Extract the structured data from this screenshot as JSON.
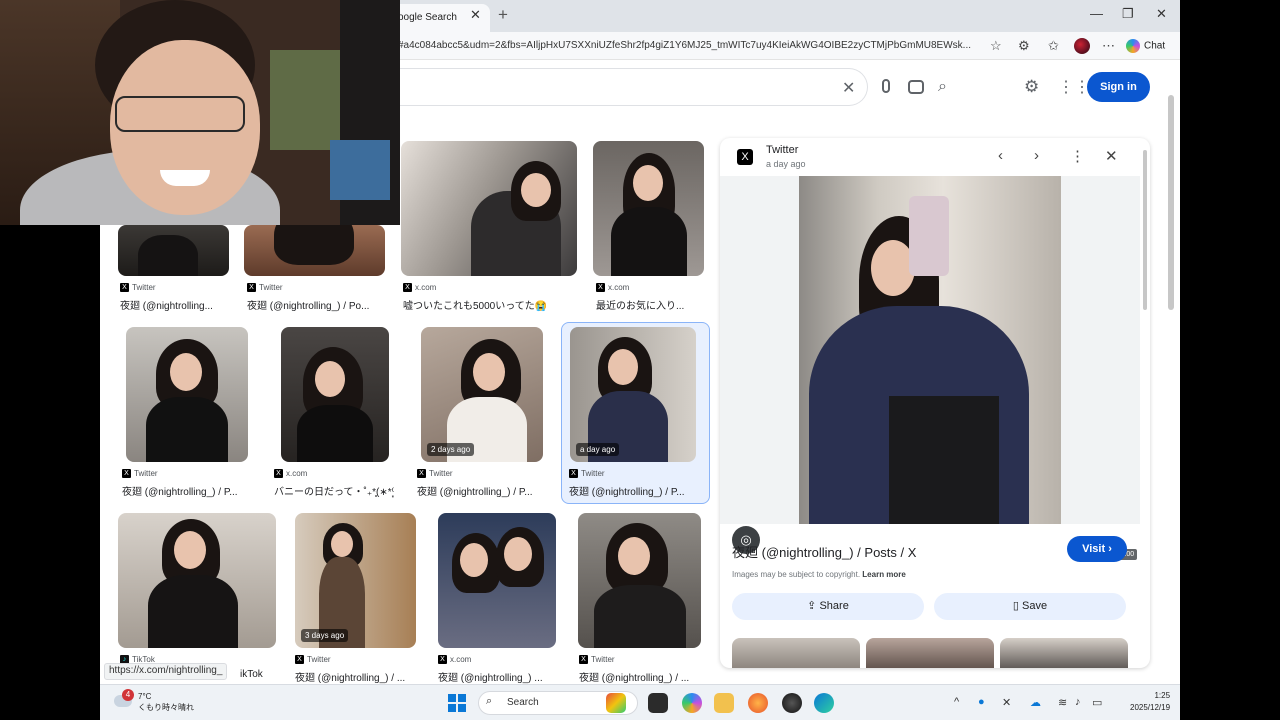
{
  "browser": {
    "tab_title": "oogle Search",
    "tab_close": "✕",
    "new_tab": "+",
    "url": "#a4c084abcc5&udm=2&fbs=AIljpHxU7SXXniUZfeShr2fp4giZ1Y6MJ25_tmWITc7uy4KIeiAkWG4OIBE2zyCTMjPbGmMU8EWsk...",
    "chat_label": "Chat",
    "window_buttons": [
      "—",
      "❐",
      "✕"
    ]
  },
  "google": {
    "signin_label": "Sign in"
  },
  "results": [
    {
      "source": "Twitter",
      "source_icon": "x",
      "caption": "夜廻 (@nightrolling..."
    },
    {
      "source": "Twitter",
      "source_icon": "x",
      "caption": "夜廻 (@nightrolling_) / Po..."
    },
    {
      "source": "x.com",
      "source_icon": "x",
      "caption": "嘘ついたこれも5000いってた😭"
    },
    {
      "source": "x.com",
      "source_icon": "x",
      "caption": "最近のお気に入り..."
    },
    {
      "source": "Twitter",
      "source_icon": "x",
      "caption": "夜廻 (@nightrolling_) / P..."
    },
    {
      "source": "x.com",
      "source_icon": "x",
      "caption": "バニーの日だって‧˚₊*̥(∗︎*⁰͈꒨⁰͈)‧˚₊*̥"
    },
    {
      "source": "Twitter",
      "source_icon": "x",
      "caption": "夜廻 (@nightrolling_) / P...",
      "ago": "2 days ago"
    },
    {
      "source": "Twitter",
      "source_icon": "x",
      "caption": "夜廻 (@nightrolling_) / P...",
      "ago": "a day ago"
    },
    {
      "source": "TikTok",
      "source_icon": "tiktok",
      "caption": "ikTok"
    },
    {
      "source": "Twitter",
      "source_icon": "x",
      "caption": "夜廻 (@nightrolling_) / ...",
      "ago": "3 days ago"
    },
    {
      "source": "x.com",
      "source_icon": "x",
      "caption": "夜廻 (@nightrolling_) ..."
    },
    {
      "source": "Twitter",
      "source_icon": "x",
      "caption": "夜廻 (@nightrolling_) / ..."
    }
  ],
  "panel": {
    "site": "Twitter",
    "time": "a day ago",
    "image_size": "900 × 1,200",
    "title": "夜廻 (@nightrolling_) / Posts / X",
    "visit_label": "Visit",
    "copyright_text": "Images may be subject to copyright.",
    "learn_more": "Learn more",
    "share_label": "Share",
    "save_label": "Save"
  },
  "status_url": "https://x.com/nightrolling_",
  "taskbar": {
    "weather_badge": "4",
    "weather_temp": "7°C",
    "weather_desc": "くもり時々晴れ",
    "search_label": "Search",
    "time": "1:25",
    "date": "2025/12/19"
  },
  "colors": {
    "accent": "#0b57d0",
    "selected_bg": "#e8f0fe"
  }
}
